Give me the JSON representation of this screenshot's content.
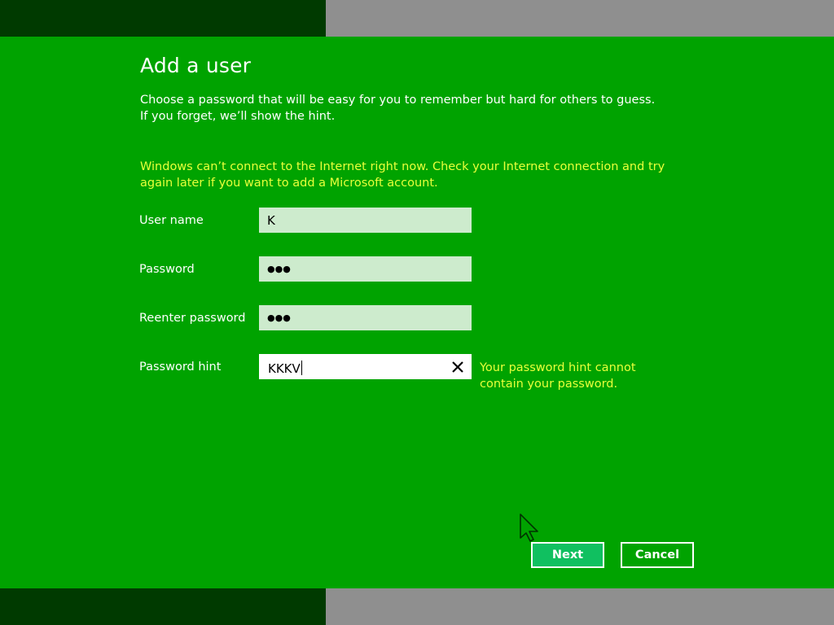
{
  "page": {
    "title": "Add a user",
    "intro": "Choose a password that will be easy for you to remember but hard for others to guess. If you forget, we’ll show the hint.",
    "warning": "Windows can’t connect to the Internet right now. Check your Internet connection and try again later if you want to add a Microsoft account."
  },
  "form": {
    "username": {
      "label": "User name",
      "value": "K"
    },
    "password": {
      "label": "Password",
      "value": "●●●"
    },
    "reenter_password": {
      "label": "Reenter password",
      "value": "●●●"
    },
    "password_hint": {
      "label": "Password hint",
      "value": "KKKV",
      "error": "Your password hint cannot contain your password."
    }
  },
  "buttons": {
    "next": "Next",
    "cancel": "Cancel"
  },
  "colors": {
    "background": "#00a300",
    "warning_text": "#e8ff3a",
    "next_button": "#10c060"
  },
  "icons": {
    "clear": "close-icon",
    "pointer": "mouse-pointer-icon"
  }
}
